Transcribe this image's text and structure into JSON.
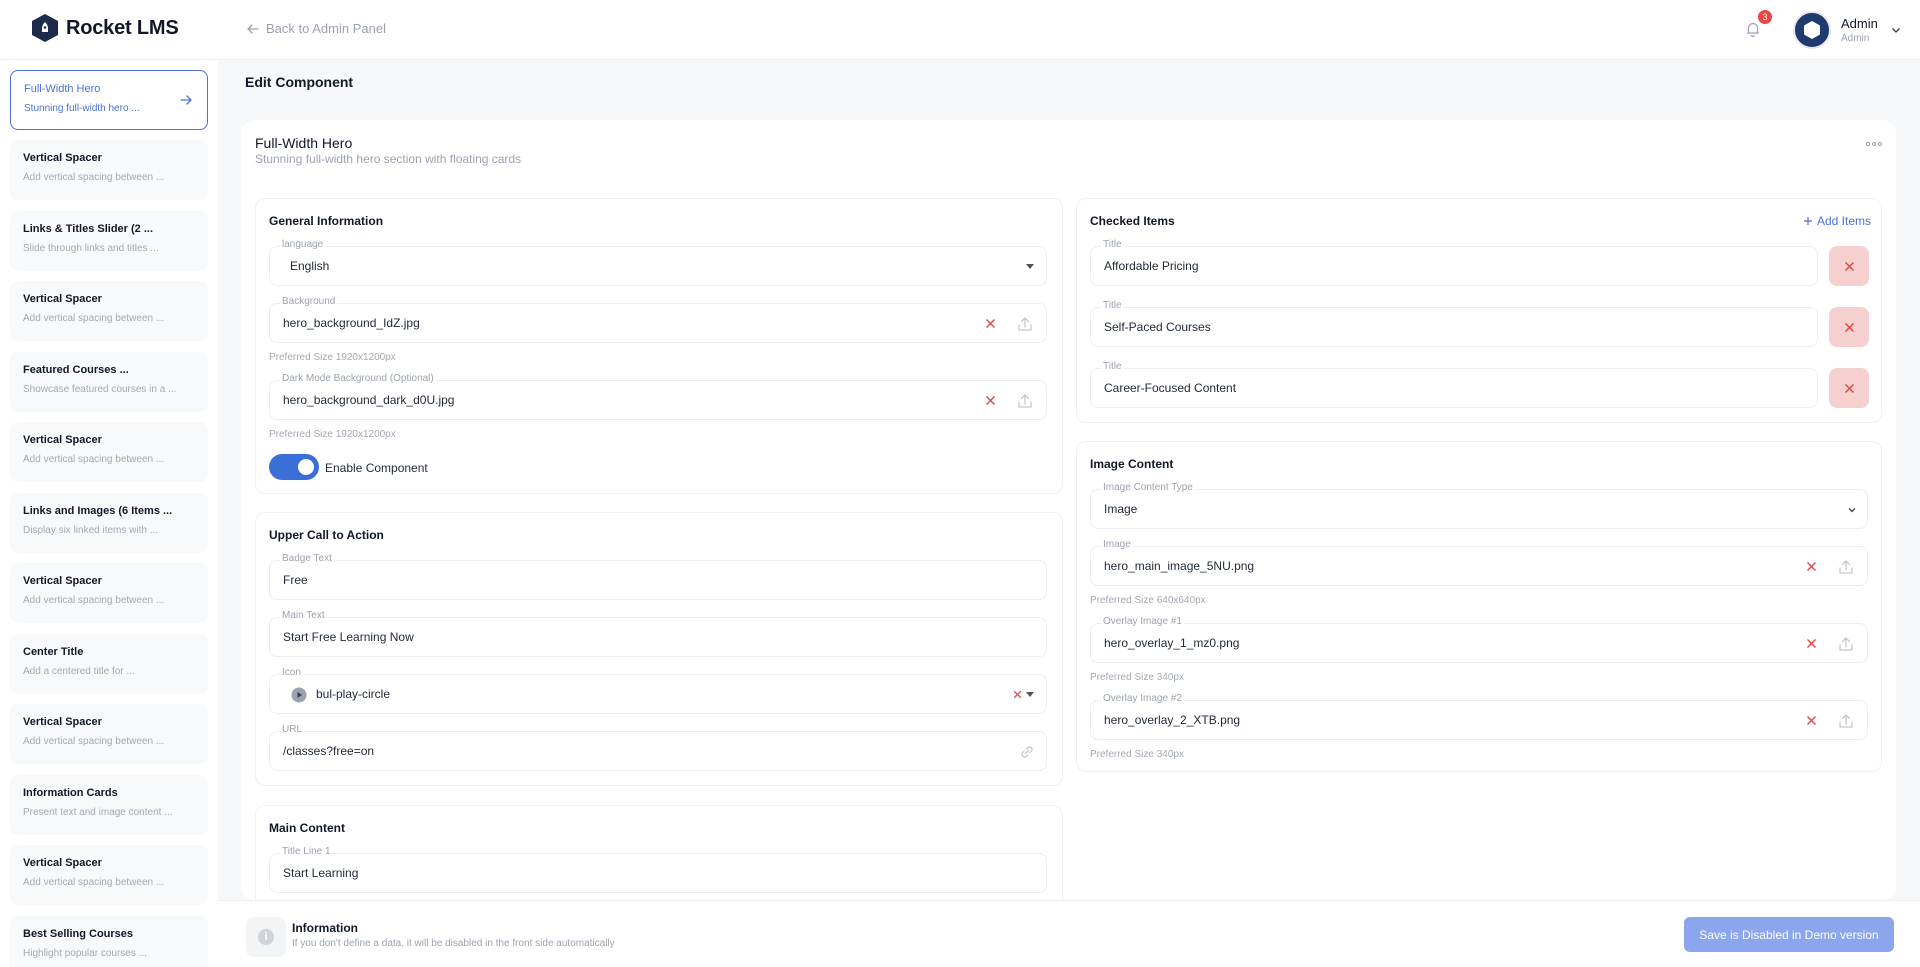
{
  "app": {
    "name": "Rocket LMS"
  },
  "header": {
    "back_label": "Back to Admin Panel",
    "notification_count": "3",
    "user_name": "Admin",
    "user_role": "Admin"
  },
  "sidebar": {
    "items": [
      {
        "title": "Full-Width Hero",
        "desc": "Stunning full-width hero ..."
      },
      {
        "title": "Vertical Spacer",
        "desc": "Add vertical spacing between ..."
      },
      {
        "title": "Links & Titles Slider (2 ...",
        "desc": "Slide through links and titles ..."
      },
      {
        "title": "Vertical Spacer",
        "desc": "Add vertical spacing between ..."
      },
      {
        "title": "Featured Courses ...",
        "desc": "Showcase featured courses in a ..."
      },
      {
        "title": "Vertical Spacer",
        "desc": "Add vertical spacing between ..."
      },
      {
        "title": "Links and Images (6 Items ...",
        "desc": "Display six linked items with ..."
      },
      {
        "title": "Vertical Spacer",
        "desc": "Add vertical spacing between ..."
      },
      {
        "title": "Center Title",
        "desc": "Add a centered title for ..."
      },
      {
        "title": "Vertical Spacer",
        "desc": "Add vertical spacing between ..."
      },
      {
        "title": "Information Cards",
        "desc": "Present text and image content ..."
      },
      {
        "title": "Vertical Spacer",
        "desc": "Add vertical spacing between ..."
      },
      {
        "title": "Best Selling Courses",
        "desc": "Highlight popular courses ..."
      }
    ]
  },
  "page": {
    "title": "Edit Component",
    "component_title": "Full-Width Hero",
    "component_subtitle": "Stunning full-width hero section with floating cards"
  },
  "general": {
    "title": "General Information",
    "language_label": "language",
    "language_value": "English",
    "background_label": "Background",
    "background_value": "hero_background_IdZ.jpg",
    "background_hint": "Preferred Size 1920x1200px",
    "dark_label": "Dark Mode Background (Optional)",
    "dark_value": "hero_background_dark_d0U.jpg",
    "dark_hint": "Preferred Size 1920x1200px",
    "enable_label": "Enable Component"
  },
  "cta": {
    "title": "Upper Call to Action",
    "badge_label": "Badge Text",
    "badge_value": "Free",
    "main_label": "Main Text",
    "main_value": "Start Free Learning Now",
    "icon_label": "Icon",
    "icon_value": "bul-play-circle",
    "url_label": "URL",
    "url_value": "/classes?free=on"
  },
  "main_content": {
    "title": "Main Content",
    "title1_label": "Title Line 1",
    "title1_value": "Start Learning"
  },
  "checked": {
    "title": "Checked Items",
    "add_label": "Add Items",
    "item_label": "Title",
    "items": [
      "Affordable Pricing",
      "Self-Paced Courses",
      "Career-Focused Content"
    ]
  },
  "image_content": {
    "title": "Image Content",
    "type_label": "Image Content Type",
    "type_value": "Image",
    "image_label": "Image",
    "image_value": "hero_main_image_5NU.png",
    "image_hint": "Preferred Size 640x640px",
    "overlay1_label": "Overlay Image #1",
    "overlay1_value": "hero_overlay_1_mz0.png",
    "overlay1_hint": "Preferred Size 340px",
    "overlay2_label": "Overlay Image #2",
    "overlay2_value": "hero_overlay_2_XTB.png",
    "overlay2_hint": "Preferred Size 340px"
  },
  "footer": {
    "info_title": "Information",
    "info_text": "If you don't define a data, it will be disabled in the front side automatically",
    "save_label": "Save is Disabled in Demo version"
  },
  "colors": {
    "accent": "#4b72d6",
    "toggle_on": "#3b6fd8",
    "danger": "#e24a4a",
    "danger_bg": "#f6cfcf",
    "save_disabled": "#8ca6ee"
  }
}
